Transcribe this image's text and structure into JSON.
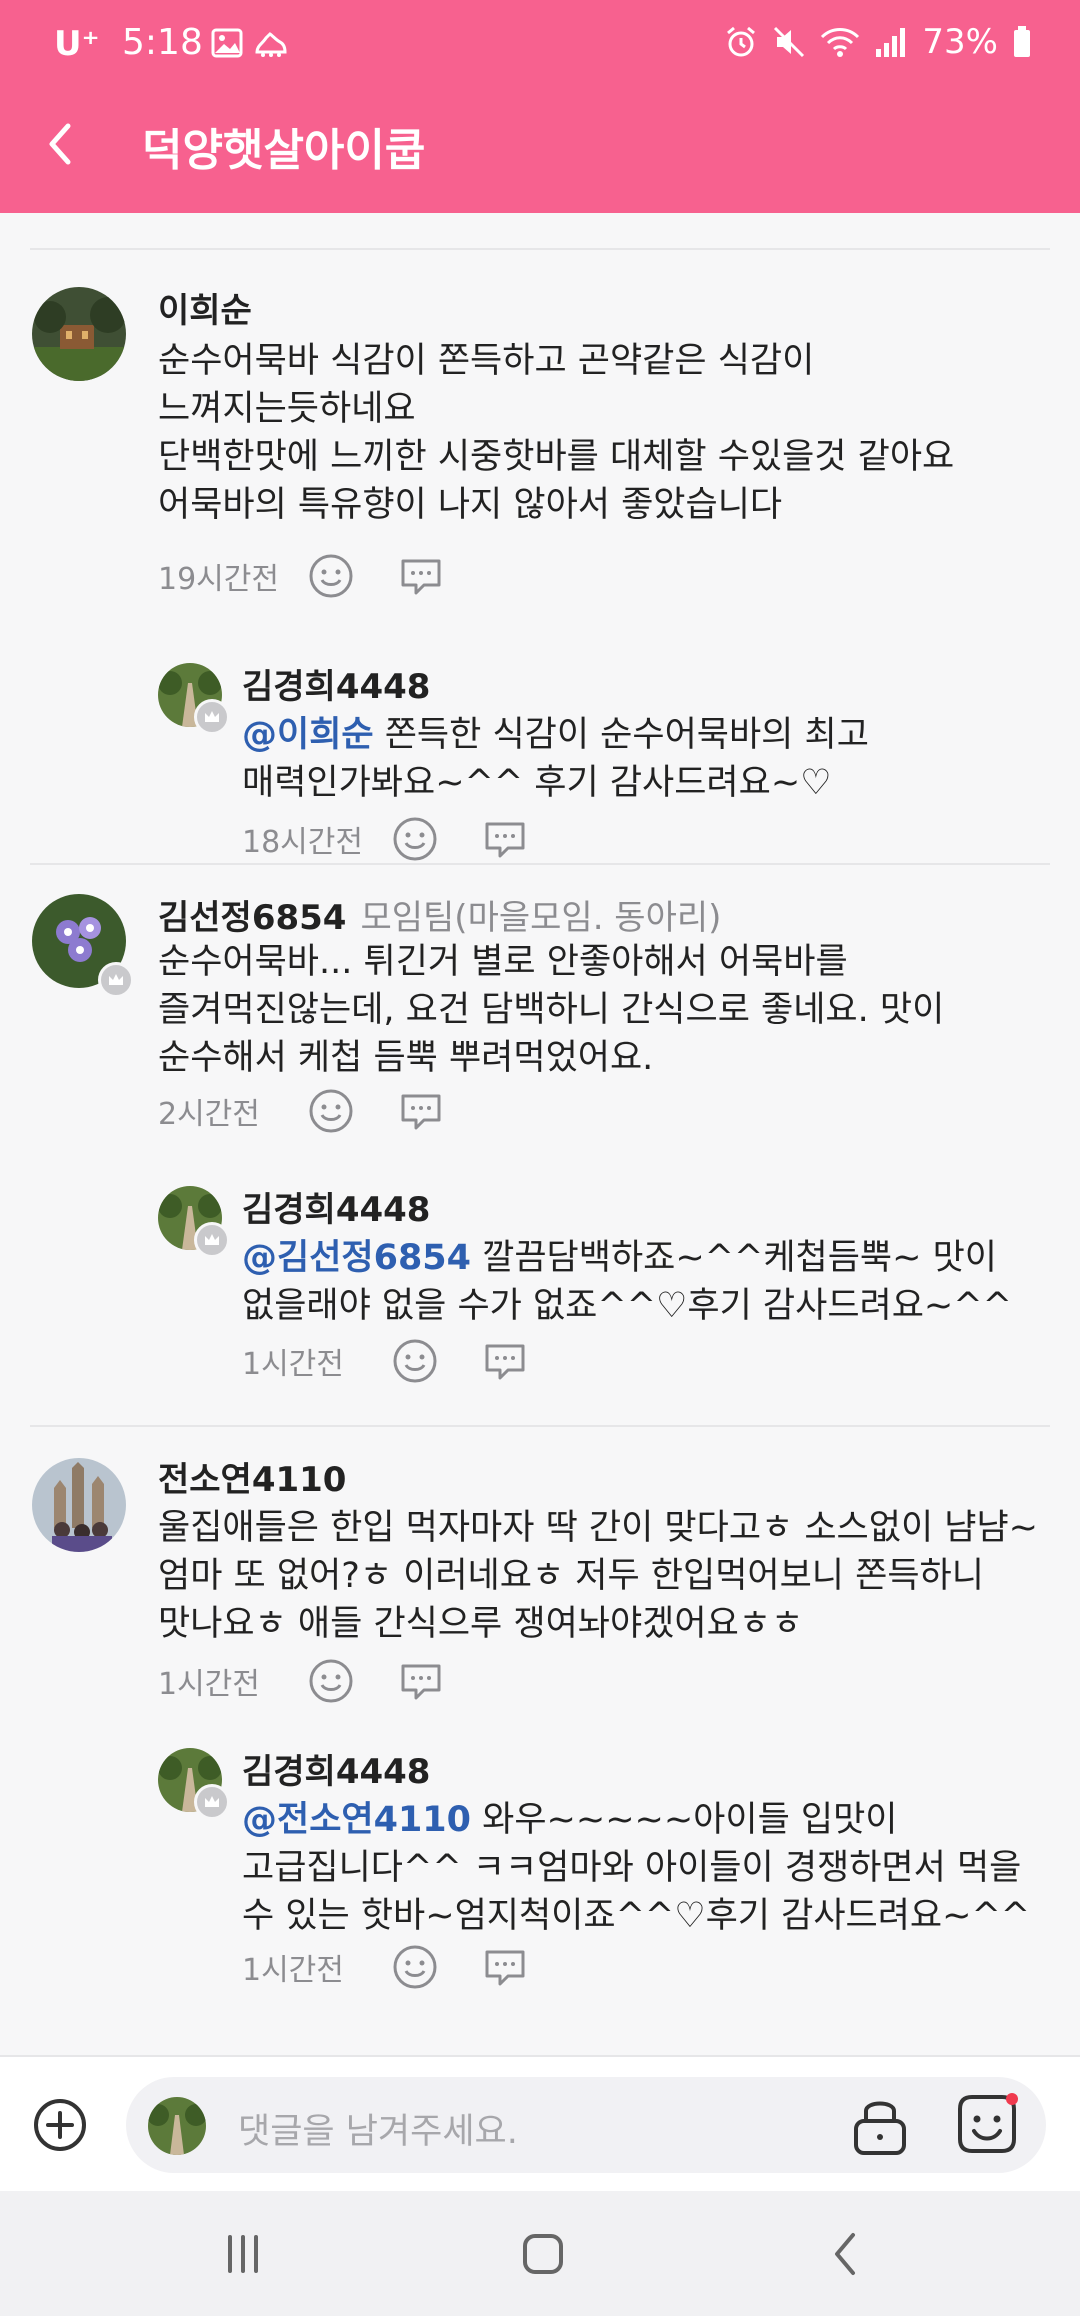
{
  "status_bar": {
    "carrier": "U⁺",
    "time": "5:18",
    "battery": "73%"
  },
  "header": {
    "title": "덕양햇살아이쿱"
  },
  "comments": [
    {
      "author": "이희순",
      "group": "",
      "mention": "",
      "text": "순수어묵바  식감이 쫀득하고 곤약같은 식감이 느껴지는듯하네요\n단백한맛에 느끼한 시중핫바를 대체할 수있을것 같아요\n어묵바의 특유향이 나지 않아서 좋았습니다",
      "time": "19시간전",
      "reply": {
        "author": "김경희4448",
        "mention": "@이희순",
        "text": " 쫀득한 식감이 순수어묵바의 최고 매력인가봐요~^^ 후기 감사드려요~♡",
        "time": "18시간전"
      }
    },
    {
      "author": "김선정6854",
      "group": "모임팀(마을모임. 동아리)",
      "mention": "",
      "text": "순수어묵바... 튀긴거 별로 안좋아해서 어묵바를 즐겨먹진않는데, 요건 담백하니 간식으로 좋네요. 맛이 순수해서 케첩 듬뿍 뿌려먹었어요.",
      "time": "2시간전",
      "reply": {
        "author": "김경희4448",
        "mention": "@김선정6854",
        "text": " 깔끔담백하죠~^^케첩듬뿍~ 맛이 없을래야 없을 수가 없죠^^♡후기 감사드려요~^^",
        "time": "1시간전"
      }
    },
    {
      "author": "전소연4110",
      "group": "",
      "mention": "",
      "text": "울집애들은 한입 먹자마자 딱 간이 맞다고ㅎ 소스없이 냠냠~엄마 또 없어?ㅎ 이러네요ㅎ 저두 한입먹어보니 쫀득하니 맛나요ㅎ 애들 간식으루 쟁여놔야겠어요ㅎㅎ",
      "time": "1시간전",
      "reply": {
        "author": "김경희4448",
        "mention": "@전소연4110",
        "text": " 와우~~~~~아이들 입맛이 고급집니다^^ ㅋㅋ엄마와 아이들이 경쟁하면서 먹을 수 있는 핫바~엄지척이죠^^♡후기 감사드려요~^^",
        "time": "1시간전"
      }
    }
  ],
  "composer": {
    "placeholder": "댓글을 남겨주세요."
  },
  "colors": {
    "header": "#f7618f",
    "mention": "#2e5fb0",
    "meta": "#8c8c90"
  }
}
